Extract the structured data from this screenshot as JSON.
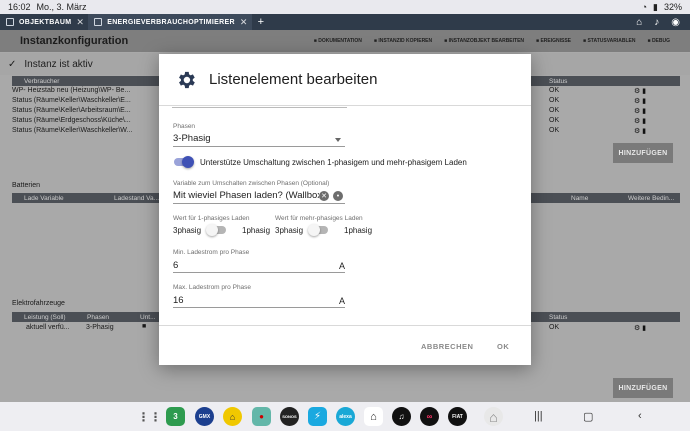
{
  "statusbar": {
    "time": "16:02",
    "date": "Mo., 3. März",
    "battery": "32%"
  },
  "tabs": [
    {
      "label": "OBJEKTBAUM"
    },
    {
      "label": "ENERGIEVERBRAUCHOPTIMIERER"
    }
  ],
  "page": {
    "title": "Instanzkonfiguration",
    "actions": [
      "DOKUMENTATION",
      "INSTANZID KOPIEREN",
      "INSTANZOBJEKT BEARBEITEN",
      "EREIGNISSE",
      "STATUSVARIABLEN",
      "DEBUG"
    ],
    "active_text": "Instanz ist aktiv",
    "table1_head_left": "Verbraucher",
    "table1_head_right": "Status",
    "table1_rows": [
      {
        "left": "WP- Heizstab neu (Heizung\\WP- Be...",
        "status": "OK"
      },
      {
        "left": "Status (Räume\\Keller\\Waschkeller\\E...",
        "status": "OK"
      },
      {
        "left": "Status (Räume\\Keller\\Arbeitsraum\\E...",
        "status": "OK"
      },
      {
        "left": "Status (Räume\\Erdgeschoss\\Küche\\...",
        "status": "OK"
      },
      {
        "left": "Status (Räume\\Keller\\Waschkeller\\W...",
        "status": "OK"
      }
    ],
    "add_label": "HINZUFÜGEN",
    "batterien_label": "Batterien",
    "batterien_head": [
      "Lade Variable",
      "Ladestand Va..."
    ],
    "batterien_head_right": [
      "Name",
      "Weitere Bedin..."
    ],
    "elektro_label": "Elektrofahrzeuge",
    "elektro_head": [
      "Leistung (Soll)",
      "Phasen",
      "Unt..."
    ],
    "elektro_head_right": "Status",
    "elektro_row": {
      "leistung": "aktuell verfü...",
      "phasen": "3-Phasig",
      "status": "OK"
    }
  },
  "dialog": {
    "title": "Listenelement bearbeiten",
    "phasen_label": "Phasen",
    "phasen_value": "3-Phasig",
    "umschaltung_text": "Unterstütze Umschaltung zwischen 1-phasigem und mehr-phasigem Laden",
    "umschaltung_on": true,
    "variable_label": "Variable zum Umschalten zwischen Phasen (Optional)",
    "variable_value": "Mit wieviel Phasen laden? (Wallbox\\",
    "wert1_label": "Wert für 1-phasiges Laden",
    "wert1_left": "3phasig",
    "wert1_right": "1phasig",
    "wertm_label": "Wert für mehr-phasiges Laden",
    "wertm_left": "3phasig",
    "wertm_right": "1phasig",
    "min_label": "Min. Ladestrom pro Phase",
    "min_value": "6",
    "min_unit": "A",
    "max_label": "Max. Ladestrom pro Phase",
    "max_value": "16",
    "max_unit": "A",
    "cancel_label": "ABBRECHEN",
    "ok_label": "OK"
  },
  "navbar": {
    "apps": [
      {
        "name": "apps-grid-icon",
        "label": "",
        "color": "#555555"
      },
      {
        "name": "calendar-app-icon",
        "label": "3",
        "color": "#2e9b4f"
      },
      {
        "name": "gmx-app-icon",
        "label": "GMX",
        "color": "#1c3f8f"
      },
      {
        "name": "bank-app-icon",
        "label": "",
        "color": "#f0c800"
      },
      {
        "name": "record-app-icon",
        "label": "",
        "color": "#63b7a9"
      },
      {
        "name": "sonos-app-icon",
        "label": "SONOS",
        "color": "#222222"
      },
      {
        "name": "bolt-app-icon",
        "label": "",
        "color": "#1aa9e0"
      },
      {
        "name": "alexa-app-icon",
        "label": "alexa",
        "color": "#19a8d6"
      },
      {
        "name": "home-app-icon",
        "label": "",
        "color": "#ffffff"
      },
      {
        "name": "music-app-icon",
        "label": "",
        "color": "#111111"
      },
      {
        "name": "rings-app-icon",
        "label": "",
        "color": "#111111"
      },
      {
        "name": "fiat-app-icon",
        "label": "FIAT",
        "color": "#111111"
      },
      {
        "name": "smarthome-app-icon",
        "label": "",
        "color": "#e8e8e8"
      }
    ]
  }
}
